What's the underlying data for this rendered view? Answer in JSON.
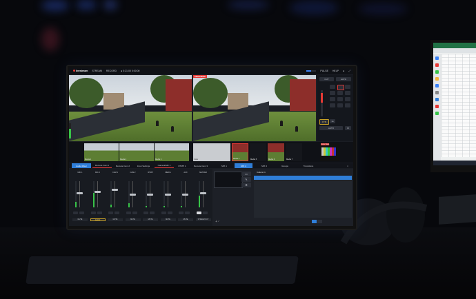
{
  "app": {
    "brand": "livestream",
    "menu_items": [
      "STREAM",
      "RECORD",
      "● 0:21:00 0:00:00"
    ],
    "right_items": [
      "PULSE",
      "HELP"
    ],
    "progress_level": 0.45
  },
  "program": {
    "label": "PROGRAM",
    "label_color": "#e53935"
  },
  "controls": {
    "top_buttons": [
      "CUT",
      "AUTO"
    ],
    "transition_label": "FTB",
    "auto_label": "AUTO",
    "duration_label": "1s"
  },
  "thumbnails": [
    {
      "label": "Media 1"
    },
    {
      "label": "Media 2"
    },
    {
      "label": "Media 3"
    },
    {
      "label": "Color"
    },
    {
      "label": "Media 4"
    },
    {
      "label": "Media 5"
    },
    {
      "label": "Media 6"
    },
    {
      "label": "Media 7"
    },
    {
      "label": "Color Bars"
    }
  ],
  "tabs_left": [
    "Audio Mixer",
    "Remote Cam 1",
    "Remote Cam 2",
    "Input Settings",
    "Camera/Mic 1",
    "RTMP 1",
    "Remote Cam 3"
  ],
  "tabs_right": [
    "MIX 1",
    "MIX 2",
    "MIX 3",
    "Groups",
    "Transitions"
  ],
  "mixer": {
    "strips": [
      {
        "name": "MIC 1",
        "fader": 0.55,
        "level": 0.2,
        "label": "MUTE"
      },
      {
        "name": "MIC 2",
        "fader": 0.6,
        "level": 0.55,
        "label": "AUDIO"
      },
      {
        "name": "CAM 1",
        "fader": 0.7,
        "level": 0.1,
        "label": "MUTE"
      },
      {
        "name": "CAM 2",
        "fader": 0.5,
        "level": 0.15,
        "label": "MUTE"
      },
      {
        "name": "RTMP",
        "fader": 0.5,
        "level": 0.05,
        "label": "MUTE"
      },
      {
        "name": "MEDIA",
        "fader": 0.5,
        "level": 0.05,
        "label": "MUTE"
      },
      {
        "name": "AUX",
        "fader": 0.5,
        "level": 0.05,
        "label": "MUTE"
      },
      {
        "name": "MASTER",
        "fader": 0.55,
        "level": 0.45,
        "label": "STREAM OUT"
      }
    ]
  },
  "right_panel": {
    "selected_row": "Column 1",
    "icons": [
      "monitor-icon",
      "pencil-icon",
      "gear-icon"
    ]
  },
  "colors": {
    "accent": "#2f7ed8",
    "live": "#e53935",
    "meter": "#38c448",
    "highlight": "#c9a227"
  }
}
